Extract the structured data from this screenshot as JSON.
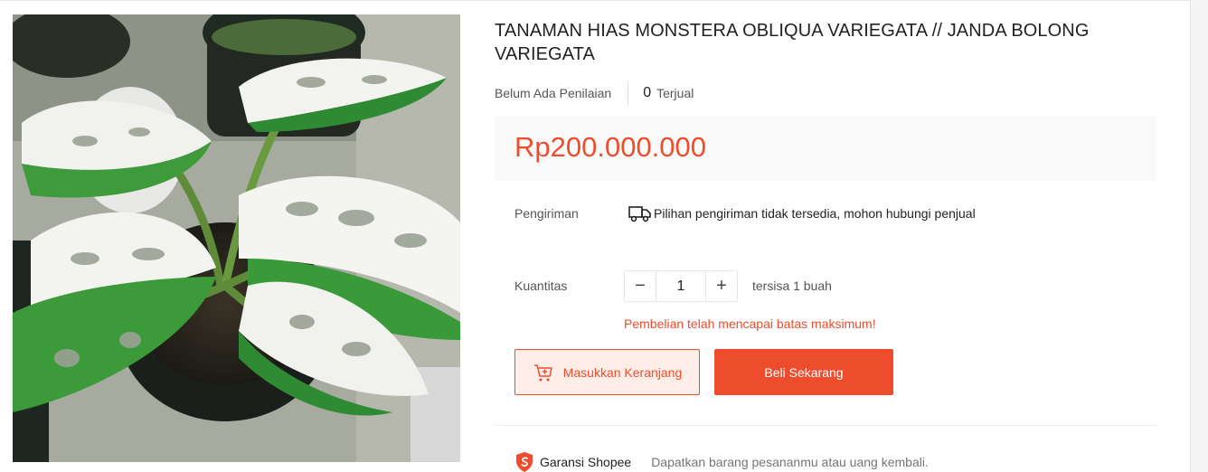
{
  "product": {
    "title": "TANAMAN HIAS MONSTERA OBLIQUA VARIEGATA // JANDA BOLONG VARIEGATA",
    "rating_text": "Belum Ada Penilaian",
    "sold_count": "0",
    "sold_label": "Terjual",
    "price": "Rp200.000.000",
    "image_icon": "monstera-plant-photo"
  },
  "shipping": {
    "label": "Pengiriman",
    "icon": "truck-icon",
    "message": "Pilihan pengiriman tidak tersedia, mohon hubungi penjual"
  },
  "quantity": {
    "label": "Kuantitas",
    "value": "1",
    "decrement": "−",
    "increment": "+",
    "stock_text": "tersisa 1 buah",
    "limit_warning": "Pembelian telah mencapai batas maksimum!"
  },
  "actions": {
    "add_to_cart": "Masukkan Keranjang",
    "buy_now": "Beli Sekarang"
  },
  "guarantee": {
    "title": "Garansi Shopee",
    "description": "Dapatkan barang pesananmu atau uang kembali."
  },
  "colors": {
    "accent": "#ee4d2d",
    "cart_bg": "#ffeee8",
    "price_bg": "#fafafa"
  }
}
